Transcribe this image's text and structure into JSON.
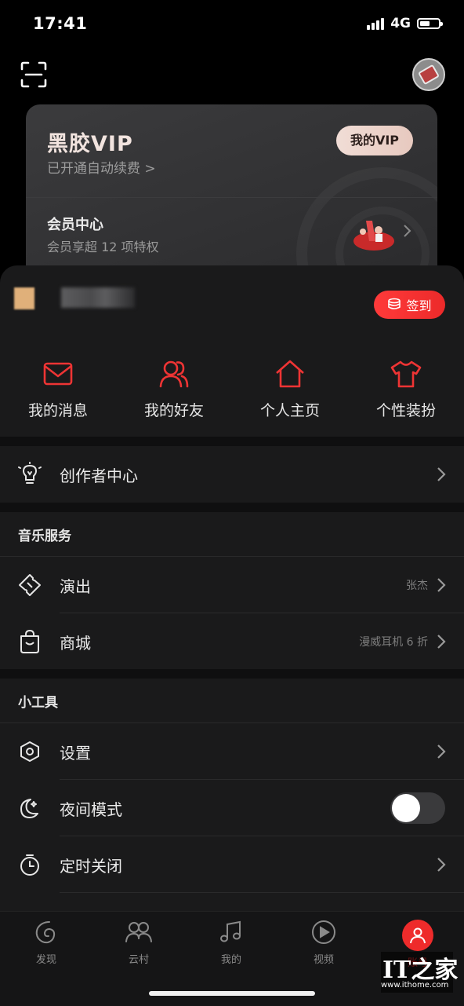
{
  "status": {
    "time": "17:41",
    "network": "4G"
  },
  "vip": {
    "title": "黑胶VIP",
    "subtitle": "已开通自动续费 >",
    "button": "我的VIP",
    "member_title": "会员中心",
    "member_sub": "会员享超 12 项特权"
  },
  "signin_label": "签到",
  "quick": [
    {
      "label": "我的消息",
      "icon": "mail-icon"
    },
    {
      "label": "我的好友",
      "icon": "friends-icon"
    },
    {
      "label": "个人主页",
      "icon": "home-icon"
    },
    {
      "label": "个性装扮",
      "icon": "shirt-icon"
    }
  ],
  "creator": {
    "label": "创作者中心"
  },
  "music_services": {
    "title": "音乐服务",
    "items": [
      {
        "label": "演出",
        "note": "张杰",
        "icon": "ticket-icon"
      },
      {
        "label": "商城",
        "note": "漫威耳机 6 折",
        "icon": "shopping-bag-icon"
      }
    ]
  },
  "tools": {
    "title": "小工具",
    "items": [
      {
        "label": "设置",
        "icon": "settings-icon"
      },
      {
        "label": "夜间模式",
        "icon": "moon-icon",
        "toggle": true
      },
      {
        "label": "定时关闭",
        "icon": "timer-icon"
      }
    ]
  },
  "tabs": [
    {
      "label": "发现",
      "icon": "discover-icon"
    },
    {
      "label": "云村",
      "icon": "community-icon"
    },
    {
      "label": "我的",
      "icon": "music-note-icon"
    },
    {
      "label": "视频",
      "icon": "video-icon"
    },
    {
      "label": "账号",
      "icon": "account-icon",
      "active": true
    }
  ],
  "watermark": {
    "logo": "IT之家",
    "url": "www.ithome.com"
  },
  "colors": {
    "accent": "#ee2b2b",
    "background": "#1a1a1b",
    "vip_button": "#ecd2c9"
  }
}
